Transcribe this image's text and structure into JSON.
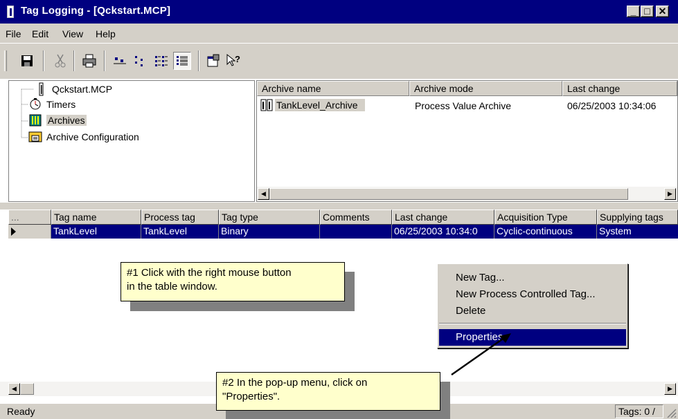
{
  "window": {
    "title": "Tag Logging - [Qckstart.MCP]"
  },
  "menu": [
    "File",
    "Edit",
    "View",
    "Help"
  ],
  "toolbar": {
    "icons": [
      "save-icon",
      "cut-icon",
      "print-icon",
      "large-icons-icon",
      "small-icons-icon",
      "list-view-icon",
      "details-view-icon",
      "properties-icon",
      "help-pointer-icon"
    ]
  },
  "tree": {
    "items": [
      {
        "label": "Qckstart.MCP",
        "icon": "project-icon"
      },
      {
        "label": "Timers",
        "icon": "timer-icon"
      },
      {
        "label": "Archives",
        "icon": "archive-icon",
        "selected": true
      },
      {
        "label": "Archive Configuration",
        "icon": "archive-config-icon"
      }
    ]
  },
  "archives": {
    "columns": [
      "Archive name",
      "Archive mode",
      "Last change"
    ],
    "rows": [
      {
        "name": "TankLevel_Archive",
        "mode": "Process Value Archive",
        "last_change": "06/25/2003 10:34:06"
      }
    ]
  },
  "tags": {
    "columns": [
      "...",
      "Tag name",
      "Process tag",
      "Tag type",
      "Comments",
      "Last change",
      "Acquisition Type",
      "Supplying tags"
    ],
    "rows": [
      {
        "tag_name": "TankLevel",
        "process_tag": "TankLevel",
        "tag_type": "Binary",
        "comments": "",
        "last_change": "06/25/2003 10:34:0",
        "acquisition_type": "Cyclic-continuous",
        "supplying_tags": "System"
      }
    ]
  },
  "context_menu": {
    "items": [
      "New Tag...",
      "New Process Controlled Tag...",
      "Delete",
      "Properties"
    ],
    "highlighted": "Properties"
  },
  "callouts": {
    "first": {
      "line1": "#1 Click with the right mouse button",
      "line2": "in the table window."
    },
    "second": {
      "line1": "#2 In the pop-up menu, click on",
      "line2": "\"Properties\"."
    }
  },
  "status": {
    "left": "Ready",
    "right": "Tags: 0 /"
  },
  "colors": {
    "title_bar": "#000080",
    "selection": "#000080",
    "callout_bg": "#ffffcc",
    "face": "#d4d0c8"
  }
}
